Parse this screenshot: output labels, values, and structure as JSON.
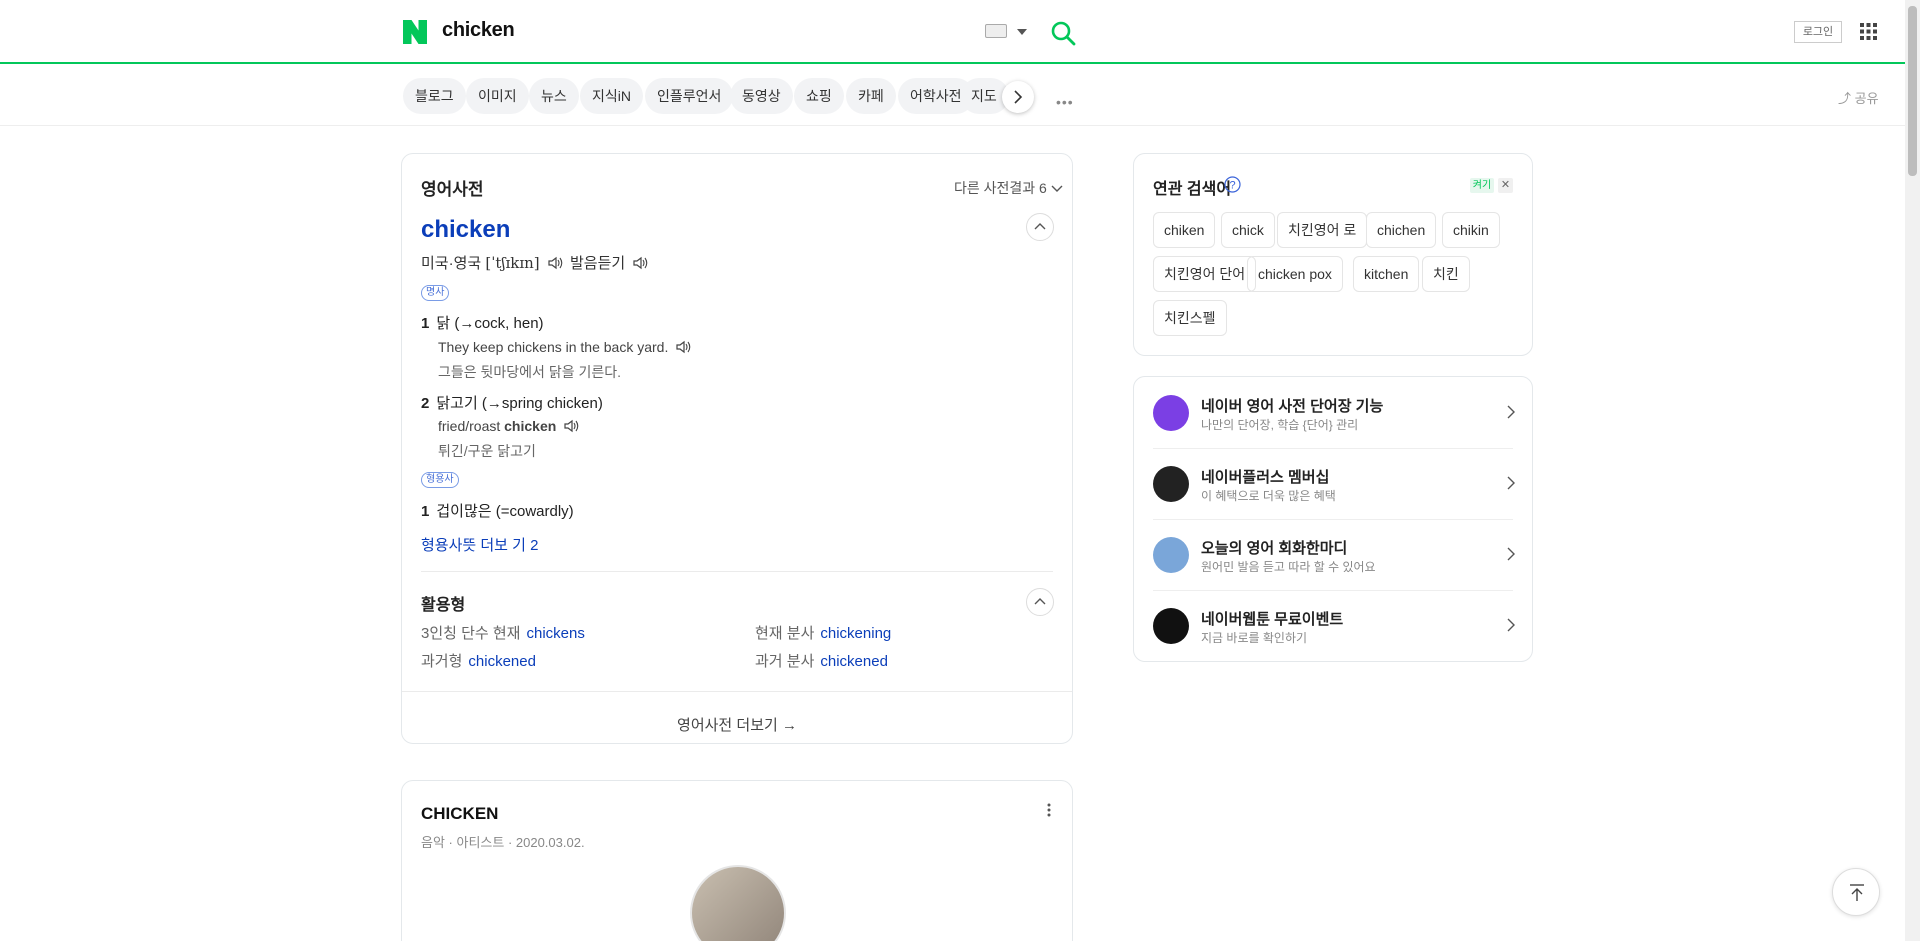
{
  "header": {
    "query": "chicken",
    "login_label": "로그인"
  },
  "tabs": [
    {
      "label": "블로그"
    },
    {
      "label": "이미지"
    },
    {
      "label": "뉴스"
    },
    {
      "label": "지식iN"
    },
    {
      "label": "인플루언서"
    },
    {
      "label": "동영상"
    },
    {
      "label": "쇼핑"
    },
    {
      "label": "카페"
    },
    {
      "label": "어학사전"
    },
    {
      "label": "지도"
    }
  ],
  "share_label": "공유",
  "dictionary": {
    "title": "영어사전",
    "count_label": "다른 사전결과 6",
    "word": "chicken",
    "pron_label": "미국·영국",
    "ipa": "[ˈtʃɪkɪn]",
    "pron_label_2": "발음듣기",
    "pos1": "명사",
    "senses": [
      {
        "num": "1",
        "text": "닭",
        "ref_prefix": "(→",
        "ref": "cock, hen",
        "ref_suffix": ")"
      },
      {
        "num": "2",
        "text": "닭고기",
        "ref_prefix": "(→",
        "ref": "spring chicken",
        "ref_suffix": ")"
      }
    ],
    "examples": [
      {
        "en": "They keep chickens in the back yard.",
        "ko": "그들은 뒷마당에서 닭을 기른다."
      },
      {
        "en": "fried/roast",
        "en_bold": "chicken",
        "ko": "튀긴/구운 닭고기"
      }
    ],
    "pos2": "형용사",
    "adj_sense": {
      "num": "1",
      "text": "겁이많은",
      "ref": "(=cowardly)"
    },
    "more_label": "형용사뜻 더보 기",
    "more_count": "2",
    "forms_title": "활용형",
    "forms": [
      {
        "label": "3인칭 단수 현재",
        "value": "chickens"
      },
      {
        "label": "현재 분사",
        "value": "chickening"
      },
      {
        "label": "과거형",
        "value": "chickened"
      },
      {
        "label": "과거 분사",
        "value": "chickened"
      }
    ],
    "footer_label": "영어사전 더보기 →"
  },
  "post": {
    "title": "CHICKEN",
    "meta_1": "음악",
    "meta_2": "아티스트",
    "date": "2020.03.02."
  },
  "related": {
    "title": "연관 검색어",
    "tag_on": "켜기",
    "tag_close": "✕",
    "chips": [
      "chiken",
      "chick",
      "치킨영어 로",
      "chichen",
      "chikin",
      "치킨영어 단어",
      "chicken pox",
      "kitchen",
      "치킨",
      "치킨스펠"
    ]
  },
  "promos": [
    {
      "title": "네이버 영어 사전 단어장 기능",
      "sub": "나만의 단어장, 학습 {단어} 관리",
      "icon_color": "#7b3fe4"
    },
    {
      "title": "네이버플러스 멤버십",
      "sub": "이 혜택으로 더욱 많은 혜택",
      "icon_color": "#222222"
    },
    {
      "title": "오늘의 영어 회화한마디",
      "sub": "원어민 발음 듣고 따라 할 수 있어요",
      "icon_color": "#7aa6d9"
    },
    {
      "title": "네이버웹툰 무료이벤트",
      "sub": "지금 바로를 확인하기",
      "icon_color": "#111111"
    }
  ],
  "colors": {
    "brand": "#03c75a",
    "link": "#0b3eb9"
  }
}
